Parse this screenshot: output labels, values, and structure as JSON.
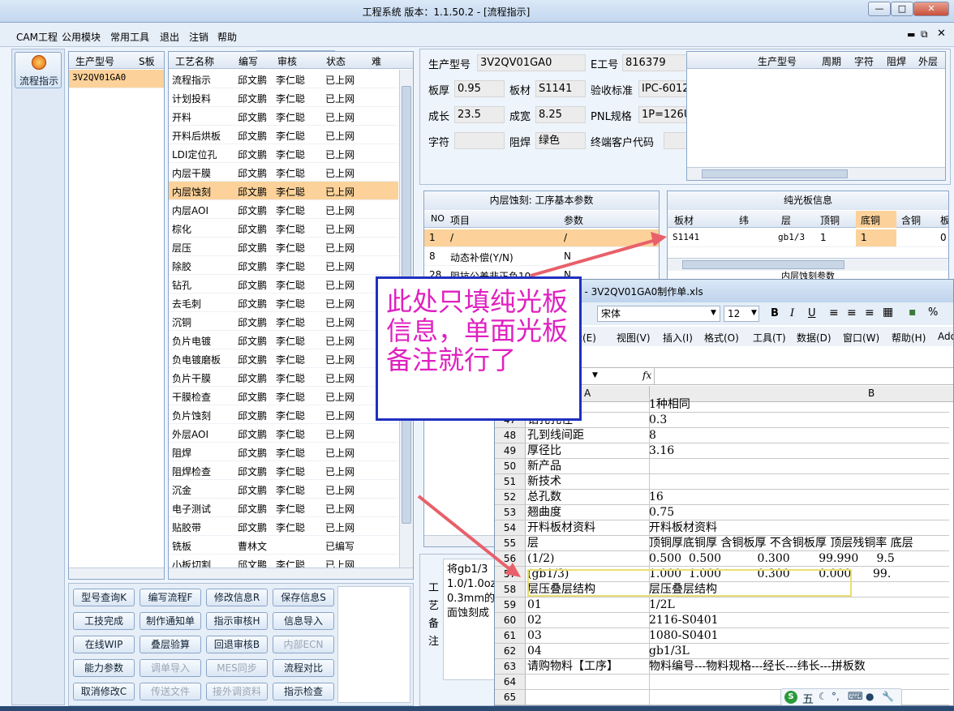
{
  "window": {
    "title": "工程系统  版本：1.1.50.2 - [流程指示]"
  },
  "menu": {
    "items": [
      "CAM工程",
      "公用模块",
      "常用工具",
      "退出",
      "注销",
      "帮助"
    ],
    "combo_value": ""
  },
  "sidebar": {
    "button_label": "流程指示"
  },
  "model_list": {
    "headers": [
      "生产型号",
      "S板"
    ],
    "rows": [
      "3V2QV01GA0"
    ]
  },
  "process_table": {
    "headers": [
      "工艺名称",
      "编写",
      "审核",
      "状态",
      "难"
    ],
    "selected_index": 6,
    "rows": [
      [
        "流程指示",
        "邱文鹏",
        "李仁聪",
        "已上网"
      ],
      [
        "计划投料",
        "邱文鹏",
        "李仁聪",
        "已上网"
      ],
      [
        "开料",
        "邱文鹏",
        "李仁聪",
        "已上网"
      ],
      [
        "开料后烘板",
        "邱文鹏",
        "李仁聪",
        "已上网"
      ],
      [
        "LDI定位孔",
        "邱文鹏",
        "李仁聪",
        "已上网"
      ],
      [
        "内层干膜",
        "邱文鹏",
        "李仁聪",
        "已上网"
      ],
      [
        "内层蚀刻",
        "邱文鹏",
        "李仁聪",
        "已上网"
      ],
      [
        "内层AOI",
        "邱文鹏",
        "李仁聪",
        "已上网"
      ],
      [
        "棕化",
        "邱文鹏",
        "李仁聪",
        "已上网"
      ],
      [
        "层压",
        "邱文鹏",
        "李仁聪",
        "已上网"
      ],
      [
        "除胶",
        "邱文鹏",
        "李仁聪",
        "已上网"
      ],
      [
        "钻孔",
        "邱文鹏",
        "李仁聪",
        "已上网"
      ],
      [
        "去毛刺",
        "邱文鹏",
        "李仁聪",
        "已上网"
      ],
      [
        "沉铜",
        "邱文鹏",
        "李仁聪",
        "已上网"
      ],
      [
        "负片电镀",
        "邱文鹏",
        "李仁聪",
        "已上网"
      ],
      [
        "负电镀磨板",
        "邱文鹏",
        "李仁聪",
        "已上网"
      ],
      [
        "负片干膜",
        "邱文鹏",
        "李仁聪",
        "已上网"
      ],
      [
        "干膜检查",
        "邱文鹏",
        "李仁聪",
        "已上网"
      ],
      [
        "负片蚀刻",
        "邱文鹏",
        "李仁聪",
        "已上网"
      ],
      [
        "外层AOI",
        "邱文鹏",
        "李仁聪",
        "已上网"
      ],
      [
        "阻焊",
        "邱文鹏",
        "李仁聪",
        "已上网"
      ],
      [
        "阻焊检查",
        "邱文鹏",
        "李仁聪",
        "已上网"
      ],
      [
        "沉金",
        "邱文鹏",
        "李仁聪",
        "已上网"
      ],
      [
        "电子测试",
        "邱文鹏",
        "李仁聪",
        "已上网"
      ],
      [
        "贴胶带",
        "邱文鹏",
        "李仁聪",
        "已上网"
      ],
      [
        "铣板",
        "曹林文",
        "",
        "已编写"
      ],
      [
        "小板切割",
        "邱文鹏",
        "李仁聪",
        "已上网"
      ]
    ]
  },
  "buttons": [
    [
      "型号查询K",
      "编写流程F",
      "修改信息R",
      "保存信息S"
    ],
    [
      "工技完成",
      "制作通知单",
      "指示审核H",
      "信息导入"
    ],
    [
      "在线WIP",
      "叠层验算",
      "回退审核B",
      "内部ECN"
    ],
    [
      "能力参数",
      "调单导入",
      "MES同步",
      "流程对比"
    ],
    [
      "取消修改C",
      "传送文件",
      "接外调资料",
      "指示检查"
    ]
  ],
  "disabled_buttons": [
    "内部ECN",
    "调单导入",
    "MES同步",
    "传送文件",
    "接外调资料"
  ],
  "info": {
    "model_label": "生产型号",
    "model_value": "3V2QV01GA0",
    "eno_label": "E工号",
    "eno_value": "816379",
    "thickness_label": "板厚",
    "thickness_value": "0.95",
    "material_label": "板材",
    "material_value": "S1141",
    "standard_label": "验收标准",
    "standard_value": "IPC-6012",
    "length_label": "成长",
    "length_value": "23.5",
    "width_label": "成宽",
    "width_value": "8.25",
    "pnl_label": "PNL规格",
    "pnl_value": "1P=126U",
    "char_label": "字符",
    "char_value": "",
    "mask_label": "阻焊",
    "mask_value": "绿色",
    "customer_label": "终端客户代码",
    "customer_value": ""
  },
  "small_grid": {
    "headers": [
      "生产型号",
      "周期",
      "字符",
      "阻焊",
      "外层"
    ]
  },
  "params": {
    "title": "内层蚀刻: 工序基本参数",
    "headers": [
      "NO",
      "项目",
      "参数"
    ],
    "rows": [
      [
        "1",
        "/",
        "/"
      ],
      [
        "8",
        "动态补偿(Y/N)",
        "N"
      ],
      [
        "28",
        "阻抗公差非正负10",
        "N"
      ]
    ]
  },
  "bare_board": {
    "title": "纯光板信息",
    "headers": [
      "板材",
      "纬",
      "层",
      "顶铜",
      "底铜",
      "含铜",
      "板"
    ],
    "row": [
      "S1141",
      "",
      "gb1/3",
      "1",
      "1",
      "",
      "0"
    ],
    "next_title": "内层蚀刻参数"
  },
  "notes": {
    "label_chars": [
      "工",
      "艺",
      "备",
      "注"
    ],
    "lines": [
      "将gb1/3",
      "1.0/1.0oz",
      "0.3mm的",
      "面蚀刻成"
    ]
  },
  "callout": {
    "text": "此处只填纯光板信息，单面光板备注就行了"
  },
  "excel": {
    "title": "el - 3V2QV01GA0制作单.xls",
    "font": "宋体",
    "size": "12",
    "toolbar": [
      "B",
      "I",
      "U",
      "%"
    ],
    "menu": [
      "辑(E)",
      "视图(V)",
      "插入(I)",
      "格式(O)",
      "工具(T)",
      "数据(D)",
      "窗口(W)",
      "帮助(H)",
      "Ado"
    ],
    "fx": "fx",
    "col_a": "A",
    "col_b": "B",
    "rows": [
      {
        "n": "",
        "a": "",
        "b": "1种相同"
      },
      {
        "n": "47",
        "a": "钻孔孔径",
        "b": "0.3"
      },
      {
        "n": "48",
        "a": "孔到线间距",
        "b": "8"
      },
      {
        "n": "49",
        "a": "厚径比",
        "b": "3.16"
      },
      {
        "n": "50",
        "a": "新产品",
        "b": ""
      },
      {
        "n": "51",
        "a": "新技术",
        "b": ""
      },
      {
        "n": "52",
        "a": "总孔数",
        "b": "16"
      },
      {
        "n": "53",
        "a": "翘曲度",
        "b": "0.75"
      },
      {
        "n": "54",
        "a": "开料板材资料",
        "b": "开料板材资料"
      },
      {
        "n": "55",
        "a": "层",
        "b": "顶铜厚底铜厚 含铜板厚 不含铜板厚 顶层残铜率 底层"
      },
      {
        "n": "56",
        "a": "(1/2)",
        "b": "0.500  0.500          0.300        99.990     9.5"
      },
      {
        "n": "57",
        "a": "(gb1/3)",
        "b": "1.000  1.000          0.300        0.000      99."
      },
      {
        "n": "58",
        "a": "层压叠层结构",
        "b": "层压叠层结构"
      },
      {
        "n": "59",
        "a": "01",
        "b": "1/2L"
      },
      {
        "n": "60",
        "a": "02",
        "b": "2116-S0401"
      },
      {
        "n": "61",
        "a": "03",
        "b": "1080-S0401"
      },
      {
        "n": "62",
        "a": "04",
        "b": "gb1/3L"
      },
      {
        "n": "63",
        "a": "请购物料【工序】",
        "b": "物料编号---物料规格---经长---纬长---拼板数"
      },
      {
        "n": "64",
        "a": "",
        "b": ""
      },
      {
        "n": "65",
        "a": "",
        "b": ""
      }
    ]
  },
  "ime": {
    "label": "五"
  },
  "colors": {
    "selected_row": "#fcd29a",
    "callout_text": "#e020c0",
    "arrow": "#e8606a",
    "highlight": "#e8e070"
  }
}
